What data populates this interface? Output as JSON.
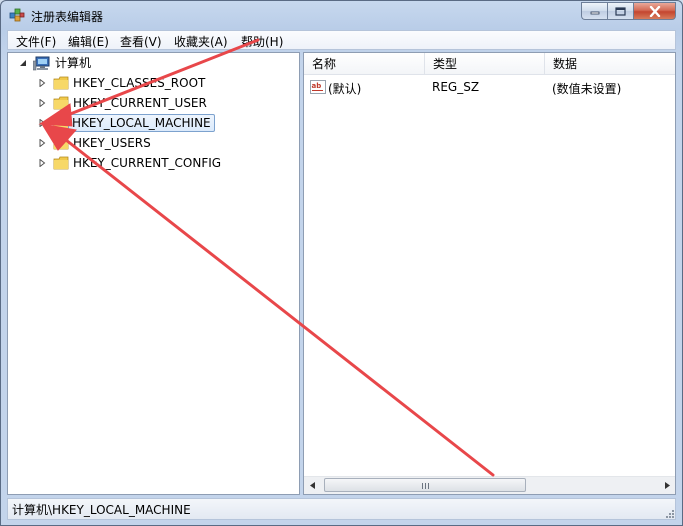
{
  "window": {
    "title": "注册表编辑器"
  },
  "menu": [
    "文件(F)",
    "编辑(E)",
    "查看(V)",
    "收藏夹(A)",
    "帮助(H)"
  ],
  "tree": {
    "root": "计算机",
    "items": [
      {
        "label": "HKEY_CLASSES_ROOT",
        "selected": false
      },
      {
        "label": "HKEY_CURRENT_USER",
        "selected": false
      },
      {
        "label": "HKEY_LOCAL_MACHINE",
        "selected": true
      },
      {
        "label": "HKEY_USERS",
        "selected": false
      },
      {
        "label": "HKEY_CURRENT_CONFIG",
        "selected": false
      }
    ]
  },
  "list": {
    "columns": [
      "名称",
      "类型",
      "数据"
    ],
    "rows": [
      {
        "name": "(默认)",
        "type": "REG_SZ",
        "data": "(数值未设置)"
      }
    ]
  },
  "status": {
    "path": "计算机\\HKEY_LOCAL_MACHINE"
  },
  "colors": {
    "annotation_arrow": "#e8474a",
    "selection_border": "#7da2ce",
    "folder": "#f0c94a"
  }
}
